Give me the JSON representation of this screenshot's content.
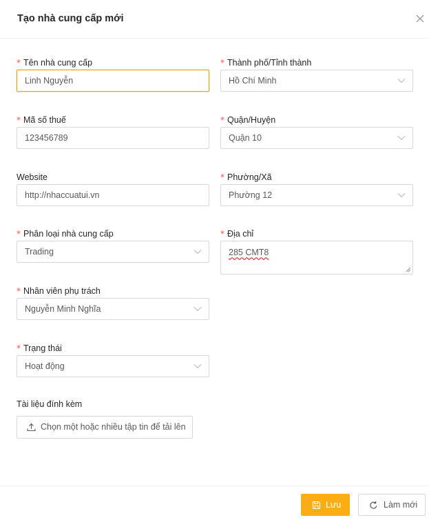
{
  "modal": {
    "title": "Tạo nhà cung cấp mới"
  },
  "form": {
    "supplier_name": {
      "label": "Tên nhà cung cấp",
      "required": true,
      "value": "Linh Nguyễn"
    },
    "tax_code": {
      "label": "Mã số thuế",
      "required": true,
      "value": "123456789"
    },
    "website": {
      "label": "Website",
      "required": false,
      "value": "http://nhaccuatui.vn"
    },
    "supplier_type": {
      "label": "Phân loại nhà cung cấp",
      "required": true,
      "value": "Trading"
    },
    "staff_in_charge": {
      "label": "Nhân viên phụ trách",
      "required": true,
      "value": "Nguyễn Minh Nghĩa"
    },
    "status": {
      "label": "Trạng thái",
      "required": true,
      "value": "Hoạt động"
    },
    "attachments": {
      "label": "Tài liệu đính kèm",
      "button_label": "Chọn một hoặc nhiều tập tin để tải lên"
    },
    "city": {
      "label": "Thành phố/Tỉnh thành",
      "required": true,
      "value": "Hồ Chí Minh"
    },
    "district": {
      "label": "Quận/Huyện",
      "required": true,
      "value": "Quận 10"
    },
    "ward": {
      "label": "Phường/Xã",
      "required": true,
      "value": "Phường 12"
    },
    "address": {
      "label": "Địa chỉ",
      "required": true,
      "value": "285 CMT8"
    }
  },
  "footer": {
    "save_label": "Lưu",
    "reset_label": "Làm mới"
  },
  "colors": {
    "primary": "#faad14",
    "required_mark": "#ff4d4f",
    "focus_border": "#f0a50a"
  },
  "icons": {
    "close": "close-icon",
    "select": "chevron-down-icon",
    "upload": "upload-icon",
    "save": "save-icon",
    "reset": "reload-icon"
  }
}
